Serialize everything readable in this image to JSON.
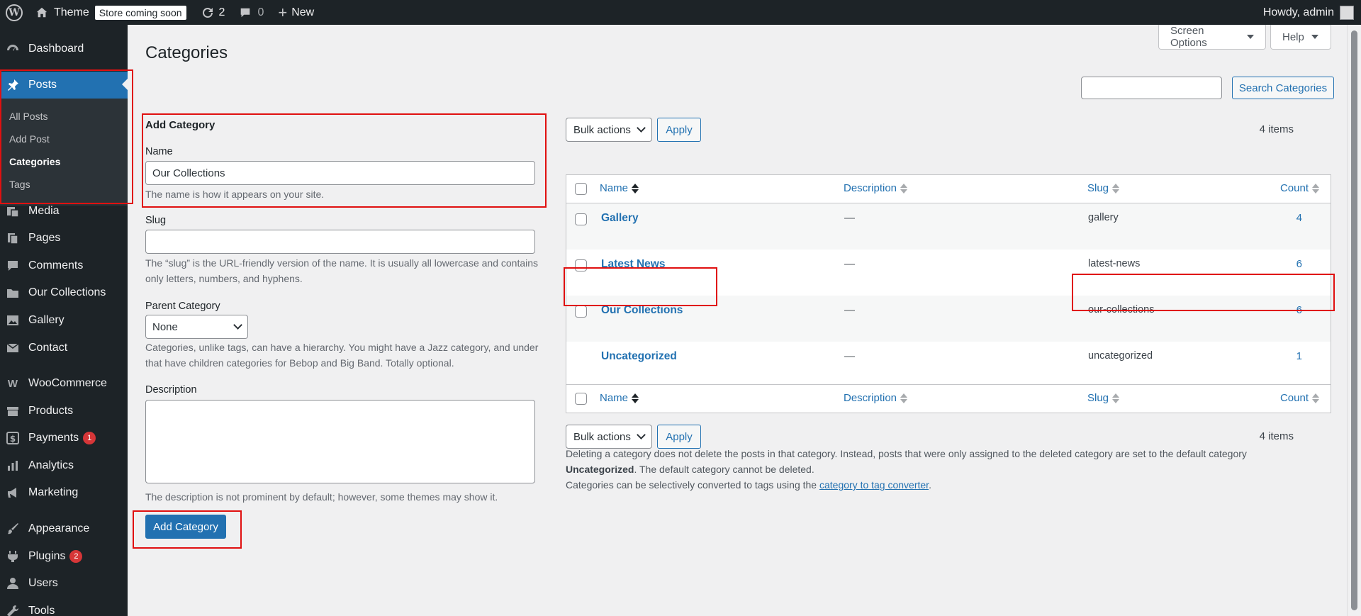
{
  "adminbar": {
    "site_name": "Theme",
    "store_badge": "Store coming soon",
    "updates_count": "2",
    "comments_count": "0",
    "new_label": "New",
    "howdy": "Howdy, admin"
  },
  "sidebar": {
    "dashboard": "Dashboard",
    "posts": "Posts",
    "submenu": [
      "All Posts",
      "Add Post",
      "Categories",
      "Tags"
    ],
    "media": "Media",
    "pages": "Pages",
    "comments": "Comments",
    "our_collections": "Our Collections",
    "gallery": "Gallery",
    "contact": "Contact",
    "woocommerce": "WooCommerce",
    "products": "Products",
    "payments": "Payments",
    "payments_badge": "1",
    "analytics": "Analytics",
    "marketing": "Marketing",
    "appearance": "Appearance",
    "plugins": "Plugins",
    "plugins_badge": "2",
    "users": "Users",
    "tools": "Tools"
  },
  "header": {
    "title": "Categories",
    "screen_options": "Screen Options",
    "help": "Help",
    "search_button": "Search Categories",
    "search_value": ""
  },
  "form": {
    "heading": "Add Category",
    "name_label": "Name",
    "name_value": "Our Collections",
    "name_help": "The name is how it appears on your site.",
    "slug_label": "Slug",
    "slug_value": "",
    "slug_help": "The “slug” is the URL-friendly version of the name. It is usually all lowercase and contains only letters, numbers, and hyphens.",
    "parent_label": "Parent Category",
    "parent_value": "None",
    "parent_help": "Categories, unlike tags, can have a hierarchy. You might have a Jazz category, and under that have children categories for Bebop and Big Band. Totally optional.",
    "description_label": "Description",
    "description_help": "The description is not prominent by default; however, some themes may show it.",
    "submit": "Add Category"
  },
  "table": {
    "bulk_actions": "Bulk actions",
    "apply": "Apply",
    "items_count": "4 items",
    "columns": {
      "name": "Name",
      "description": "Description",
      "slug": "Slug",
      "count": "Count"
    },
    "rows": [
      {
        "name": "Gallery",
        "description": "—",
        "slug": "gallery",
        "count": "4"
      },
      {
        "name": "Latest News",
        "description": "—",
        "slug": "latest-news",
        "count": "6"
      },
      {
        "name": "Our Collections",
        "description": "—",
        "slug": "our-collections",
        "count": "6"
      },
      {
        "name": "Uncategorized",
        "description": "—",
        "slug": "uncategorized",
        "count": "1"
      }
    ]
  },
  "notes": {
    "line1_start": "Deleting a category does not delete the posts in that category. Instead, posts that were only assigned to the deleted category are set to the default category ",
    "line1_bold": "Uncategorized",
    "line1_end": ". The default category cannot be deleted.",
    "line2_start": "Categories can be selectively converted to tags using the ",
    "line2_link": "category to tag converter",
    "line2_end": "."
  },
  "colors": {
    "accent": "#2271b1",
    "adminbar": "#1d2327",
    "highlight": "#e01010"
  }
}
